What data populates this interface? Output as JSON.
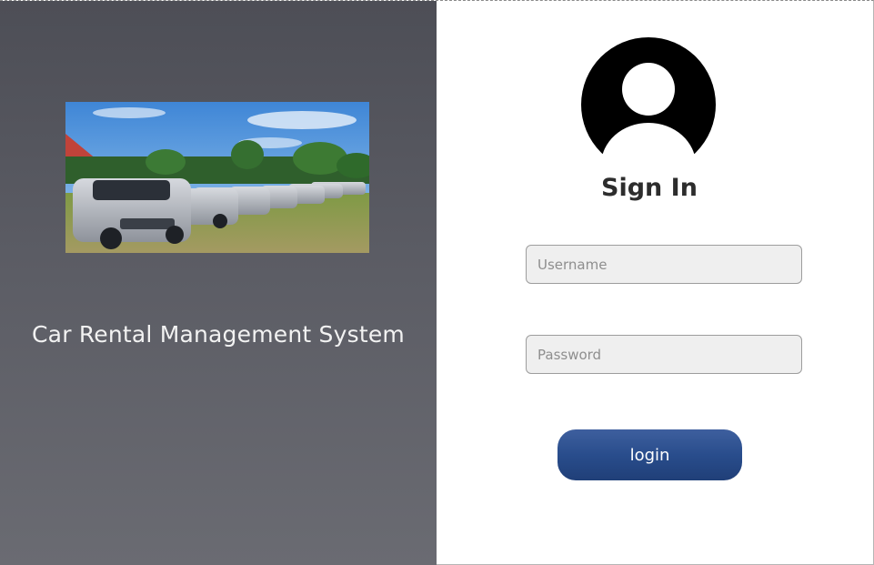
{
  "left_panel": {
    "app_title": "Car Rental Management System"
  },
  "sign_in": {
    "heading": "Sign In",
    "username": {
      "value": "",
      "placeholder": "Username"
    },
    "password": {
      "value": "",
      "placeholder": "Password"
    },
    "login_label": "login"
  },
  "icons": {
    "avatar": "user-avatar-icon"
  },
  "colors": {
    "left_panel_bg": "#55565e",
    "button_bg": "#294d8c",
    "input_bg": "#efefef"
  }
}
